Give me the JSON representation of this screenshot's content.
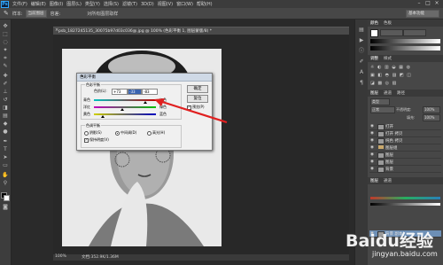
{
  "app": {
    "logo": "Ps",
    "menu": [
      "文件(F)",
      "编辑(E)",
      "图像(I)",
      "图层(L)",
      "类型(Y)",
      "选择(S)",
      "滤镜(T)",
      "3D(D)",
      "视图(V)",
      "窗口(W)",
      "帮助(H)"
    ]
  },
  "options_bar": {
    "label1": "样本:",
    "field1": "当前图层",
    "label2": "容差:",
    "check_label": "对所有图层取样",
    "right_field": "基本功能"
  },
  "document": {
    "tab_title": "psb_1827245135_30075b97d03c036@.jpg @ 100% (色彩平衡 1, 图层蒙版/8) *",
    "zoom": "100%",
    "doc_info": "文档:352.9K/1.36M"
  },
  "dialog": {
    "title": "色彩平衡",
    "group1_label": "色彩平衡",
    "levels_label": "色阶(L):",
    "levels": [
      "+73",
      "-33",
      "-83"
    ],
    "left_labels": [
      "青色",
      "洋红",
      "黄色"
    ],
    "right_labels": [
      "红色",
      "绿色",
      "蓝色"
    ],
    "group2_label": "色调平衡",
    "tones": [
      "阴影(S)",
      "中间调(D)",
      "高光(H)"
    ],
    "preserve": "保持明度(V)",
    "ok": "确定",
    "cancel": "复位",
    "preview": "预览(P)"
  },
  "panels": {
    "top_tabs": [
      "颜色",
      "色板"
    ],
    "adj_tabs": [
      "调整",
      "样式"
    ],
    "layers_tabs": [
      "图层",
      "通道",
      "路径"
    ],
    "kind": "类型",
    "blend_mode": "正常",
    "opacity_label": "不透明度:",
    "opacity": "100%",
    "fill_label": "填充:",
    "fill": "100%",
    "layers": [
      {
        "name": "打开"
      },
      {
        "name": "打开 拷贝"
      },
      {
        "name": "纯色 拷贝"
      },
      {
        "name": "图层组"
      },
      {
        "name": "图层"
      },
      {
        "name": "图层"
      },
      {
        "name": "背景"
      }
    ],
    "bottom_layer": "背景 副本"
  },
  "watermark": {
    "text": "Baidu经验",
    "url": "jingyan.baidu.com"
  }
}
